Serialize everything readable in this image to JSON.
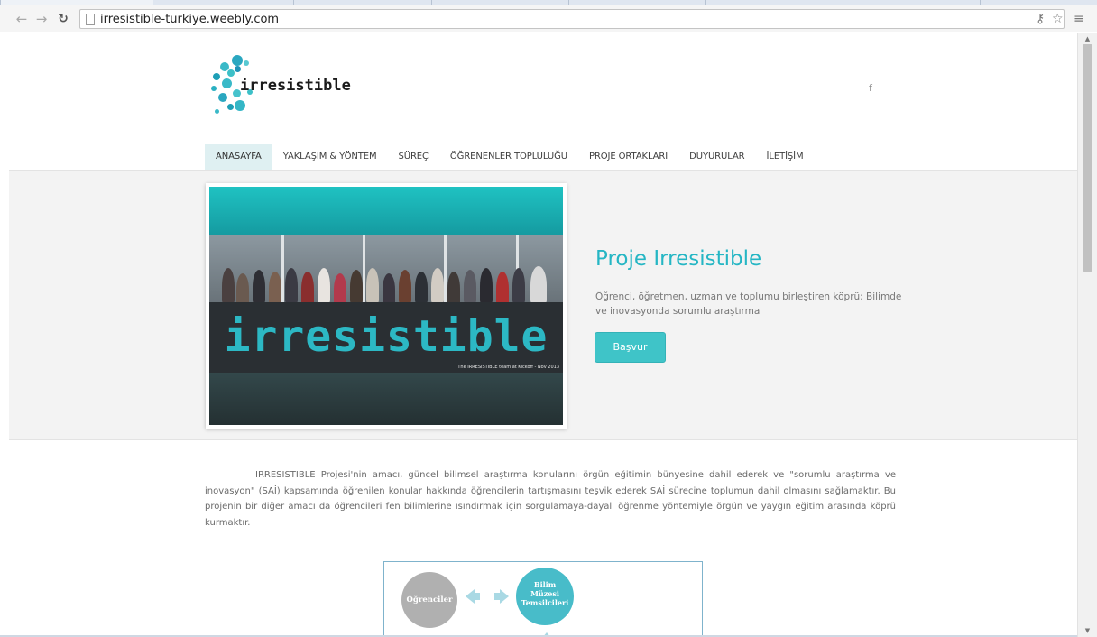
{
  "browser": {
    "url": "irresistible-turkiye.weebly.com",
    "back_icon": "back-arrow-icon",
    "forward_icon": "forward-arrow-icon",
    "reload_icon": "reload-icon"
  },
  "site": {
    "logo_text": "irresistible",
    "brand_colors": {
      "accent": "#25b6c4",
      "button": "#3fc4c8",
      "nav_active_bg": "#dff0f2"
    },
    "social_fb": "f"
  },
  "nav": {
    "items": [
      {
        "label": "ANASAYFA",
        "active": true
      },
      {
        "label": "YAKLAŞIM & YÖNTEM",
        "active": false
      },
      {
        "label": "SÜREÇ",
        "active": false
      },
      {
        "label": "ÖĞRENENLER TOPLULUĞU",
        "active": false
      },
      {
        "label": "PROJE ORTAKLARI",
        "active": false
      },
      {
        "label": "DUYURULAR",
        "active": false
      },
      {
        "label": "İLETİŞİM",
        "active": false
      }
    ]
  },
  "hero": {
    "image_text": "irresistible",
    "image_caption": "The IRRESISTIBLE team at Kickoff - Nov 2013",
    "title": "Proje Irresistible",
    "subtitle": "Öğrenci, öğretmen, uzman ve toplumu birleştiren köprü: Bilimde ve inovasyonda sorumlu araştırma",
    "button_label": "Başvur"
  },
  "intro": {
    "text": "IRRESISTIBLE Projesi'nin amacı, güncel bilimsel araştırma konularını örgün eğitimin bünyesine dahil ederek ve \"sorumlu araştırma ve inovasyon\" (SAİ) kapsamında öğrenilen konular hakkında öğrencilerin tartışmasını teşvik ederek SAİ sürecine toplumun dahil olmasını sağlamaktır. Bu projenin bir diğer amacı da öğrencileri fen bilimlerine ısındırmak için sorgulamaya-dayalı öğrenme yöntemiyle örgün ve yaygın eğitim arasında köprü kurmaktır."
  },
  "diagram": {
    "node_students": "Öğrenciler",
    "node_museum_1": "Bilim",
    "node_museum_2": "Müzesi",
    "node_museum_3": "Temsilcileri"
  }
}
